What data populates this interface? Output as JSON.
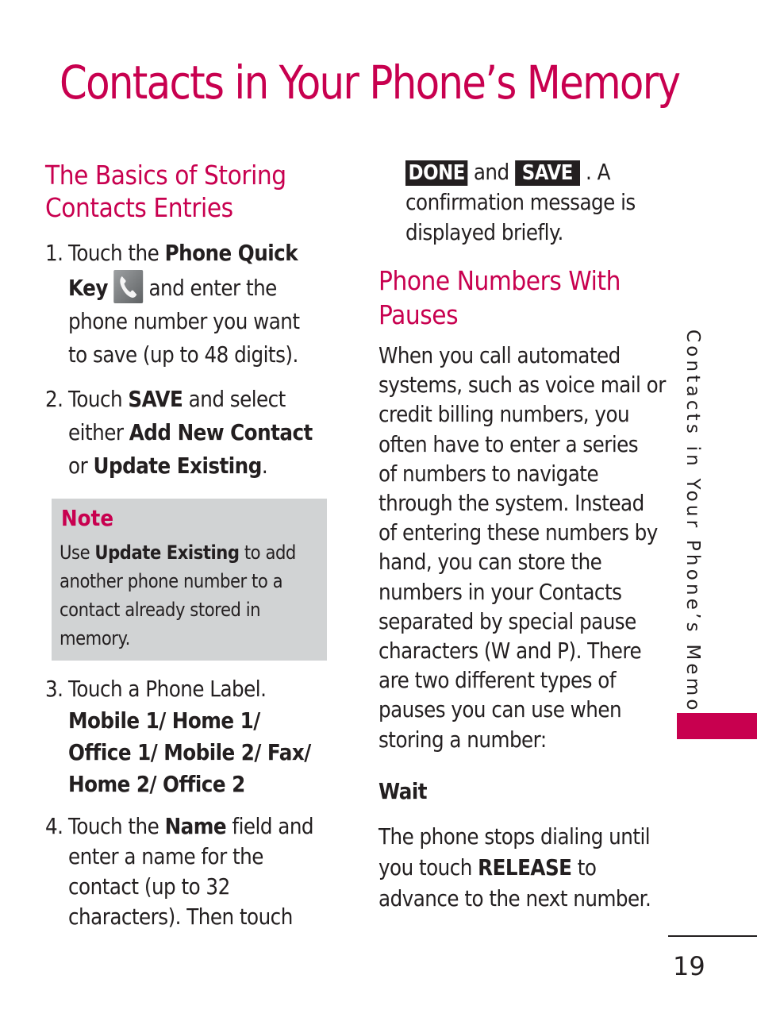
{
  "page": {
    "title": "Contacts in Your Phone’s Memory",
    "page_number": "19",
    "side_tab": "Contacts in Your Phone’s Memory",
    "accent_color": "#c8004f"
  },
  "left_column": {
    "heading_line1": "The Basics of Storing",
    "heading_line2": "Contacts Entries",
    "steps": [
      {
        "number": "1.",
        "l1_a": "Touch the ",
        "l1_b": "Phone Quick",
        "l2_a": "Key",
        "l2_icon": "phone-quick-key-icon",
        "l2_b": " and enter the",
        "l3": "phone number you want",
        "l4": "to save (up to 48 digits)."
      },
      {
        "number": "2.",
        "l1_a": "Touch ",
        "l1_b": "SAVE",
        "l1_c": " and select",
        "l2_a": "either ",
        "l2_b": "Add New Contact",
        "l3_a": "or ",
        "l3_b": "Update Existing",
        "l3_c": "."
      },
      {
        "number": "3.",
        "l1": "Touch a Phone Label.",
        "l2": "Mobile 1/ Home 1/",
        "l3": "Office 1/ Mobile 2/ Fax/",
        "l4": "Home 2/ Office 2"
      },
      {
        "number": "4.",
        "l1_a": "Touch the ",
        "l1_b": "Name",
        "l1_c": " field and",
        "l2": "enter a name for the",
        "l3": "contact (up to 32",
        "l4": "characters). Then touch"
      }
    ],
    "note": {
      "title": "Note",
      "l1_a": "Use ",
      "l1_b": "Update Existing",
      "l1_c": " to add",
      "l2": "another phone number to a",
      "l3": "contact already stored in",
      "l4": "memory."
    }
  },
  "right_column": {
    "continuation": {
      "button1": "DONE",
      "between": " and ",
      "button2": "SAVE",
      "after": " . A",
      "l2": "confirmation message is",
      "l3": "displayed briefly."
    },
    "heading_line1": "Phone Numbers With",
    "heading_line2": "Pauses",
    "paragraph_lines": [
      "When you call automated",
      "systems, such as voice mail or",
      "credit billing numbers, you",
      "often have to enter a series",
      "of numbers to navigate",
      "through the system. Instead",
      "of entering these numbers by",
      "hand, you can store the",
      "numbers in your Contacts",
      "separated by special pause",
      "characters (W and P). There",
      "are two different types of",
      "pauses you can use when",
      "storing a number:"
    ],
    "wait": {
      "title": "Wait",
      "l1": "The phone stops dialing until",
      "l2_a": "you touch ",
      "l2_b": "RELEASE",
      "l2_c": " to",
      "l3": "advance to the next number."
    }
  }
}
